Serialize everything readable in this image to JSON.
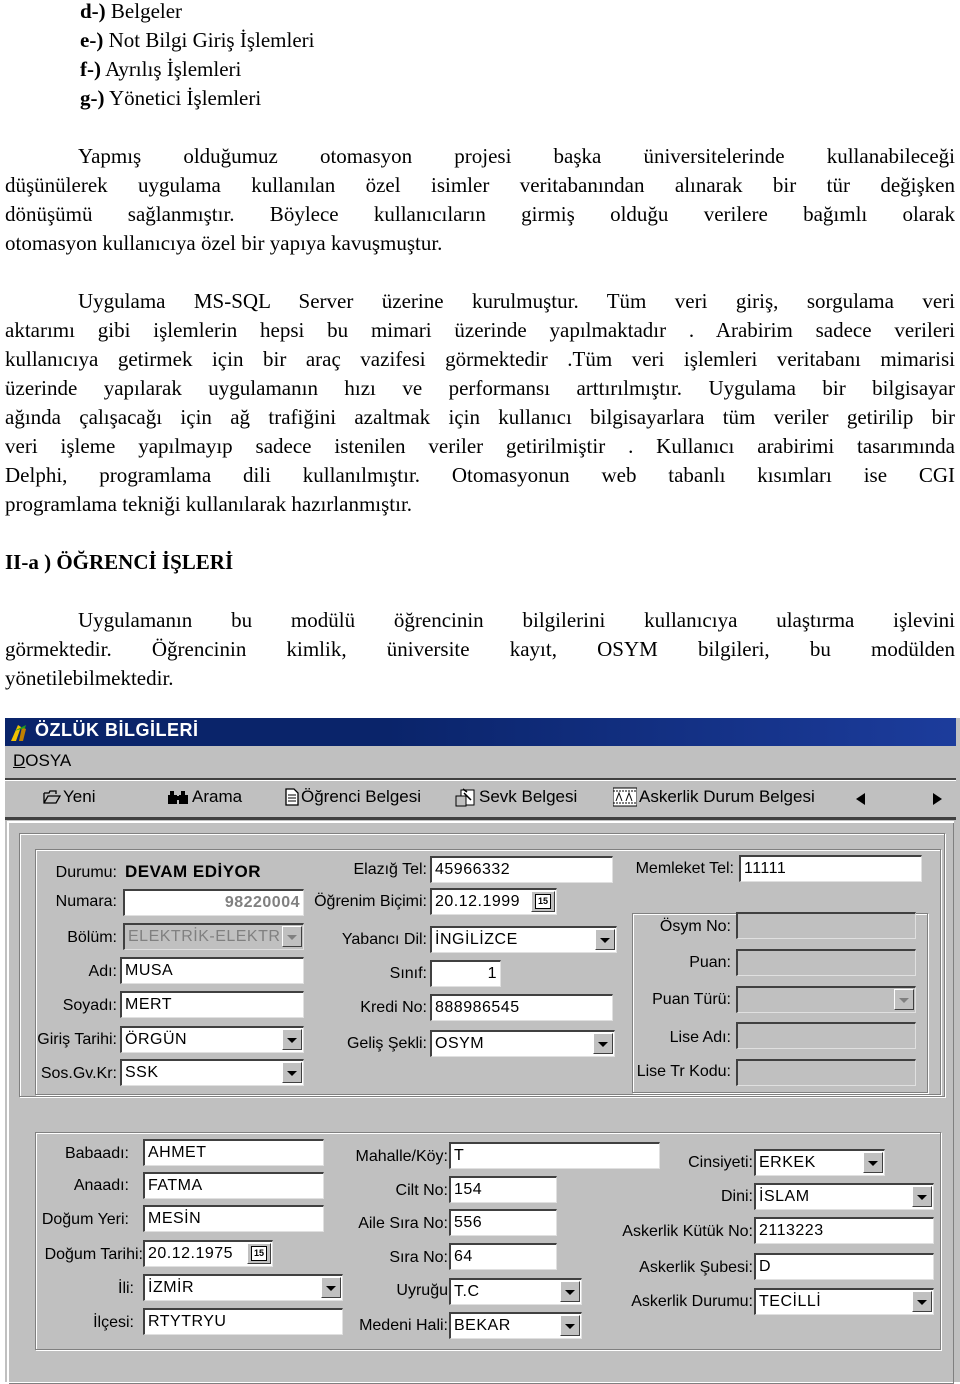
{
  "document": {
    "list": [
      {
        "marker": "d-)",
        "text": "Belgeler"
      },
      {
        "marker": "e-)",
        "text": "Not Bilgi Giriş İşlemleri"
      },
      {
        "marker": "f-)",
        "text": "Ayrılış İşlemleri"
      },
      {
        "marker": "g-)",
        "text": "Yönetici İşlemleri"
      }
    ],
    "paragraph1": [
      "Yapmış olduğumuz otomasyon projesi başka üniversitelerinde kullanabileceği",
      "düşünülerek  uygulama kullanılan özel isimler  veritabanından alınarak bir tür değişken",
      "dönüşümü sağlanmıştır. Böylece kullanıcıların girmiş olduğu verilere bağımlı olarak",
      "otomasyon kullanıcıya özel bir yapıya kavuşmuştur."
    ],
    "paragraph2": [
      "Uygulama MS-SQL Server üzerine kurulmuştur. Tüm veri giriş, sorgulama  veri",
      "aktarımı gibi işlemlerin hepsi bu mimari üzerinde yapılmaktadır . Arabirim sadece verileri",
      "kullanıcıya getirmek için bir araç vazifesi görmektedir .Tüm veri işlemleri veritabanı mimarisi",
      "üzerinde yapılarak uygulamanın hızı ve performansı arttırılmıştır. Uygulama bir bilgisayar",
      "ağında çalışacağı için ağ trafiğini azaltmak için kullanıcı bilgisayarlara tüm veriler getirilip bir",
      "veri işleme yapılmayıp sadece istenilen veriler getirilmiştir . Kullanıcı arabirimi tasarımında",
      "Delphi, programlama dili kullanılmıştır. Otomasyonun web tabanlı kısımları ise CGI",
      "programlama tekniği kullanılarak hazırlanmıştır."
    ],
    "section_heading": "II-a ) ÖĞRENCİ İŞLERİ",
    "paragraph3": [
      "Uygulamanın bu modülü öğrencinin bilgilerini kullanıcıya ulaştırma işlevini",
      "görmektedir. Öğrencinin kimlik, üniversite kayıt, OSYM bilgileri, bu modülden",
      "yönetilebilmektedir."
    ]
  },
  "window": {
    "title": "ÖZLÜK BİLGİLERİ",
    "title_bar_color": "#0a246a",
    "menu": {
      "accel": "D",
      "rest": "OSYA"
    },
    "toolbar": [
      {
        "label": "Yeni",
        "icon": "folder-open-icon"
      },
      {
        "label": "Arama",
        "icon": "binoculars-icon"
      },
      {
        "label": "Öğrenci Belgesi",
        "icon": "document-icon"
      },
      {
        "label": "Sevk Belgesi",
        "icon": "transfer-document-icon"
      },
      {
        "label": "Askerlik Durum Belgesi",
        "icon": "film-strip-icon"
      }
    ],
    "student": {
      "durumu_label": "Durumu:",
      "durumu_value": "DEVAM EDİYOR",
      "numara_label": "Numara:",
      "numara_value": "98220004",
      "bolum_label": "Bölüm:",
      "bolum_value": "ELEKTRİK-ELEKTR",
      "adi_label": "Adı:",
      "adi_value": "MUSA",
      "soyadi_label": "Soyadı:",
      "soyadi_value": "MERT",
      "giris_tarihi_label": "Giriş Tarihi:",
      "giris_tarihi_value": "ÖRGÜN",
      "sosgvkr_label": "Sos.Gv.Kr:",
      "sosgvkr_value": "SSK",
      "elazig_tel_label": "Elazığ Tel:",
      "elazig_tel_value": "45966332",
      "ogrenim_bicimi_label": "Öğrenim Biçimi:",
      "ogrenim_bicimi_value": "20.12.1999",
      "yabanci_dil_label": "Yabancı Dil:",
      "yabanci_dil_value": "İNGİLİZCE",
      "sinif_label": "Sınıf:",
      "sinif_value": "1",
      "kredi_no_label": "Kredi No:",
      "kredi_no_value": "888986545",
      "gelis_sekli_label": "Geliş Şekli:",
      "gelis_sekli_value": "OSYM",
      "memleket_tel_label": "Memleket Tel:",
      "memleket_tel_value": "11111",
      "osym_no_label": "Ösym No:",
      "osym_no_value": "",
      "puan_label": "Puan:",
      "puan_value": "",
      "puan_turu_label": "Puan Türü:",
      "puan_turu_value": "",
      "lise_adi_label": "Lise Adı:",
      "lise_adi_value": "",
      "lise_tr_kodu_label": "Lise Tr Kodu:",
      "lise_tr_kodu_value": ""
    },
    "identity": {
      "babaadi_label": "Babaadı:",
      "babaadi_value": "AHMET",
      "anaadi_label": "Anaadı:",
      "anaadi_value": "FATMA",
      "dogum_yeri_label": "Doğum Yeri:",
      "dogum_yeri_value": "MESİN",
      "dogum_tarihi_label": "Doğum Tarihi:",
      "dogum_tarihi_value": "20.12.1975",
      "ili_label": "İli:",
      "ili_value": "İZMİR",
      "ilcesi_label": "İlçesi:",
      "ilcesi_value": "RTYTRYU",
      "mahalle_label": "Mahalle/Köy:",
      "mahalle_value": "T",
      "cilt_no_label": "Cilt No:",
      "cilt_no_value": "154",
      "aile_sira_no_label": "Aile Sıra No:",
      "aile_sira_no_value": "556",
      "sira_no_label": "Sıra No:",
      "sira_no_value": "64",
      "uyrugu_label": "Uyruğu",
      "uyrugu_value": "T.C",
      "medeni_hali_label": "Medeni Hali:",
      "medeni_hali_value": "BEKAR",
      "cinsiyeti_label": "Cinsiyeti:",
      "cinsiyeti_value": "ERKEK",
      "dini_label": "Dini:",
      "dini_value": "İSLAM",
      "askerlik_kutuk_label": "Askerlik Kütük No:",
      "askerlik_kutuk_value": "2113223",
      "askerlik_subesi_label": "Askerlik Şubesi:",
      "askerlik_subesi_value": "D",
      "askerlik_durumu_label": "Askerlik Durumu:",
      "askerlik_durumu_value": "TECİLLİ"
    },
    "calendar_icon_text": "15"
  }
}
